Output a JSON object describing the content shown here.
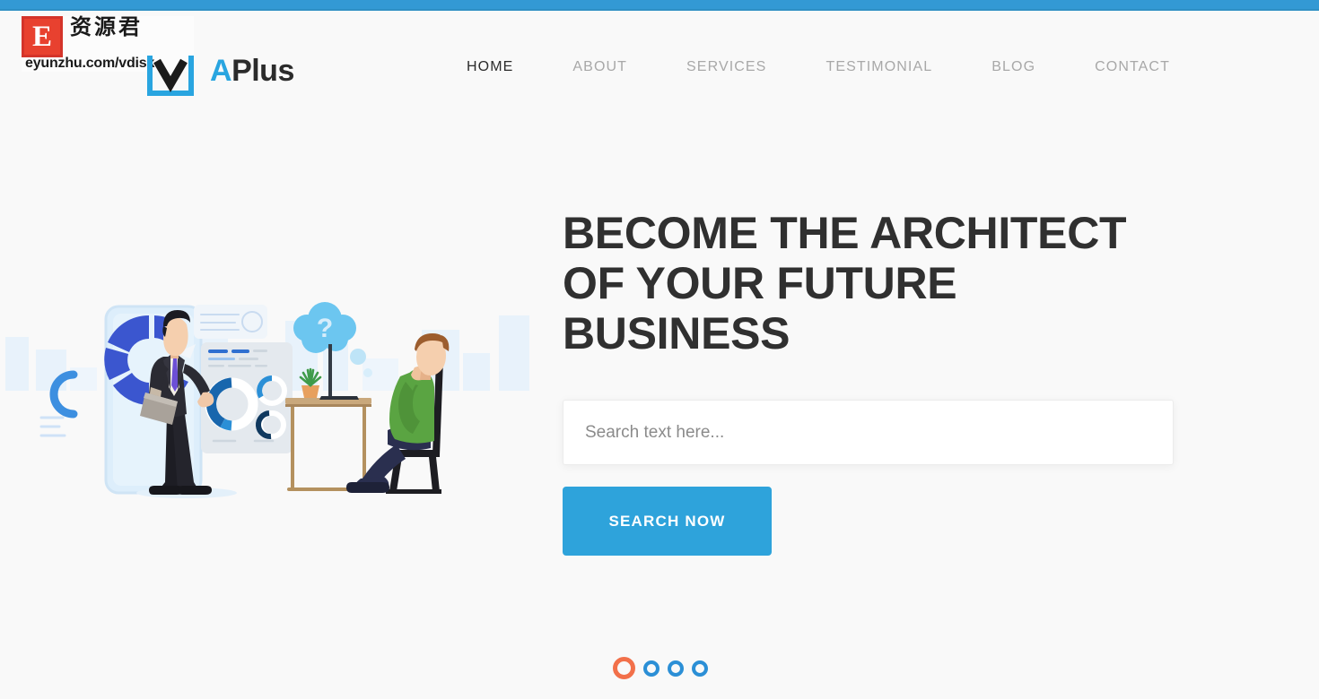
{
  "site": {
    "brand_accent_letter": "A",
    "brand_rest": "Plus",
    "accent_color": "#29a5e0",
    "topbar_color": "#3399d4",
    "background_color": "#f9f9f9"
  },
  "nav": {
    "items": [
      {
        "label": "HOME",
        "active": true
      },
      {
        "label": "ABOUT",
        "active": false
      },
      {
        "label": "SERVICES",
        "active": false
      },
      {
        "label": "TESTIMONIAL",
        "active": false
      },
      {
        "label": "BLOG",
        "active": false
      },
      {
        "label": "CONTACT",
        "active": false
      }
    ]
  },
  "hero": {
    "title": "BECOME THE ARCHITECT\nOF YOUR FUTURE BUSINESS",
    "title_line_1": "BECOME THE ARCHITECT",
    "title_line_2": "OF YOUR FUTURE BUSINESS",
    "title_color": "#303030",
    "search": {
      "placeholder": "Search text here...",
      "value": ""
    },
    "search_button_label": "SEARCH NOW",
    "search_button_color": "#2ea3db"
  },
  "carousel": {
    "total": 4,
    "active_index": 1,
    "active_color": "#f2704a",
    "idle_color": "#2b8fd6",
    "dots": [
      {
        "index": 1,
        "active": true
      },
      {
        "index": 2,
        "active": false
      },
      {
        "index": 3,
        "active": false
      },
      {
        "index": 4,
        "active": false
      }
    ]
  },
  "illustration": {
    "name": "business-consulting-illustration",
    "description": "Standing businessman with briefcase beside a large smartphone and analytics dashboard, and a seated discouraged man at a desk with a plant and laptop, with a question-mark thought cloud",
    "thought_bubble_symbol": "?"
  },
  "watermark": {
    "badge_letter": "E",
    "chinese_text": "资源君",
    "url": "eyunzhu.com/vdisk",
    "badge_color": "#e8412f",
    "check_color": "#29a5e0"
  }
}
